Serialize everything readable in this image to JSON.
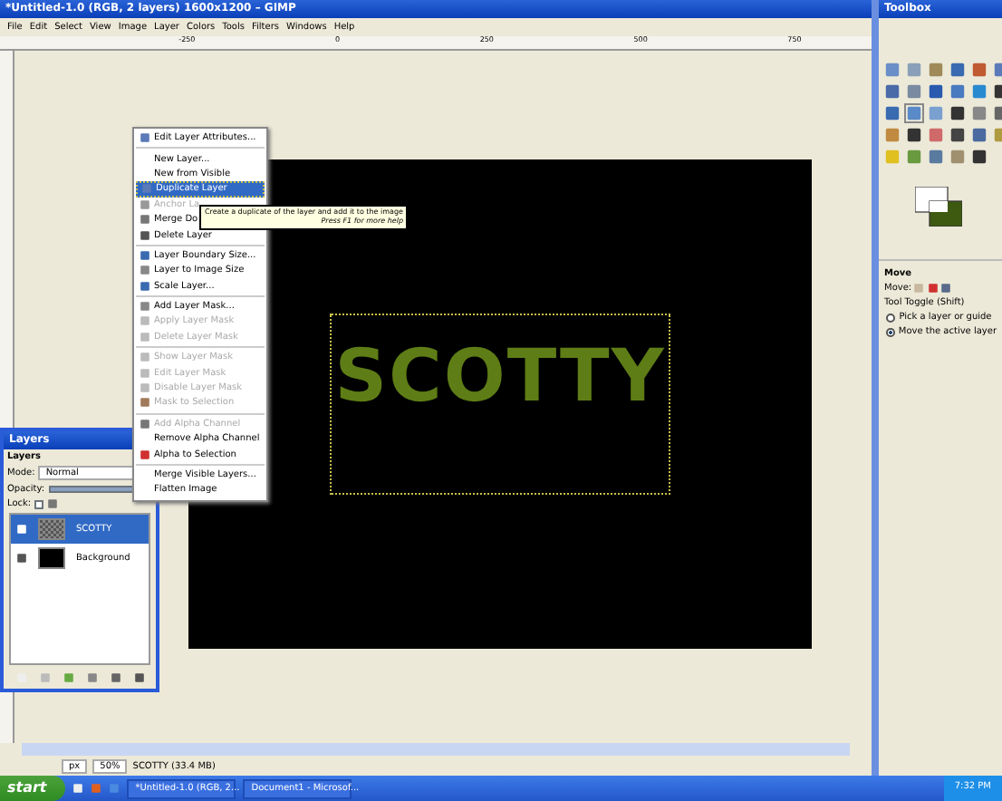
{
  "window": {
    "title": "*Untitled-1.0 (RGB, 2 layers) 1600x1200 – GIMP"
  },
  "menu": [
    "File",
    "Edit",
    "Select",
    "View",
    "Image",
    "Layer",
    "Colors",
    "Tools",
    "Filters",
    "Windows",
    "Help"
  ],
  "ruler": [
    "-250",
    "0",
    "250",
    "500",
    "750"
  ],
  "canvas": {
    "text": "SCOTTY"
  },
  "context_menu": [
    {
      "kind": "item",
      "label": "Edit Layer Attributes...",
      "disabled": false,
      "selected": false
    },
    {
      "kind": "separator"
    },
    {
      "kind": "item",
      "label": "New Layer...",
      "disabled": false,
      "selected": false
    },
    {
      "kind": "item",
      "label": "New from Visible",
      "disabled": false,
      "selected": false
    },
    {
      "kind": "item",
      "label": "Duplicate Layer",
      "disabled": false,
      "selected": true
    },
    {
      "kind": "item",
      "label": "Anchor La",
      "disabled": true,
      "selected": false
    },
    {
      "kind": "item",
      "label": "Merge Do",
      "disabled": false,
      "selected": false
    },
    {
      "kind": "item",
      "label": "Delete Layer",
      "disabled": false,
      "selected": false
    },
    {
      "kind": "separator"
    },
    {
      "kind": "item",
      "label": "Layer Boundary Size...",
      "disabled": false,
      "selected": false
    },
    {
      "kind": "item",
      "label": "Layer to Image Size",
      "disabled": false,
      "selected": false
    },
    {
      "kind": "item",
      "label": "Scale Layer...",
      "disabled": false,
      "selected": false
    },
    {
      "kind": "separator"
    },
    {
      "kind": "item",
      "label": "Add Layer Mask...",
      "disabled": false,
      "selected": false
    },
    {
      "kind": "item",
      "label": "Apply Layer Mask",
      "disabled": true,
      "selected": false
    },
    {
      "kind": "item",
      "label": "Delete Layer Mask",
      "disabled": true,
      "selected": false
    },
    {
      "kind": "separator"
    },
    {
      "kind": "item",
      "label": "Show Layer Mask",
      "disabled": true,
      "selected": false
    },
    {
      "kind": "item",
      "label": "Edit Layer Mask",
      "disabled": true,
      "selected": false
    },
    {
      "kind": "item",
      "label": "Disable Layer Mask",
      "disabled": true,
      "selected": false
    },
    {
      "kind": "item",
      "label": "Mask to Selection",
      "disabled": true,
      "selected": false
    },
    {
      "kind": "separator"
    },
    {
      "kind": "item",
      "label": "Add Alpha Channel",
      "disabled": true,
      "selected": false
    },
    {
      "kind": "item",
      "label": "Remove Alpha Channel",
      "disabled": false,
      "selected": false
    },
    {
      "kind": "item",
      "label": "Alpha to Selection",
      "disabled": false,
      "selected": false
    },
    {
      "kind": "separator"
    },
    {
      "kind": "item",
      "label": "Merge Visible Layers...",
      "disabled": false,
      "selected": false
    },
    {
      "kind": "item",
      "label": "Flatten Image",
      "disabled": false,
      "selected": false
    }
  ],
  "tooltip": {
    "text": "Create a duplicate of the layer and add it to the image",
    "hint": "Press F1 for more help"
  },
  "layers_dialog": {
    "title": "Layers",
    "tab": "Layers",
    "mode_label": "Mode:",
    "mode": "Normal",
    "opacity_label": "Opacity:",
    "opacity_slider": {
      "level": 1
    },
    "lock_label": "Lock:",
    "lock_pixels": {
      "checked": false
    },
    "layers": [
      {
        "name": "SCOTTY",
        "selected": true
      },
      {
        "name": "Background",
        "selected": false
      }
    ]
  },
  "toolbox": {
    "title": "Toolbox",
    "options_title": "Move",
    "move_label": "Move:",
    "toggle_label": "Tool Toggle (Shift)",
    "options": [
      {
        "label": "Pick a layer or guide",
        "selected": false
      },
      {
        "label": "Move the active layer",
        "selected": true
      }
    ]
  },
  "status_bar": {
    "unit": "px",
    "zoom": "50%",
    "info": "SCOTTY (33.4 MB)"
  },
  "taskbar": {
    "start": "start",
    "tasks": [
      "*Untitled-1.0 (RGB, 2...",
      "Document1 - Microsof..."
    ],
    "clock": "7:32 PM"
  }
}
